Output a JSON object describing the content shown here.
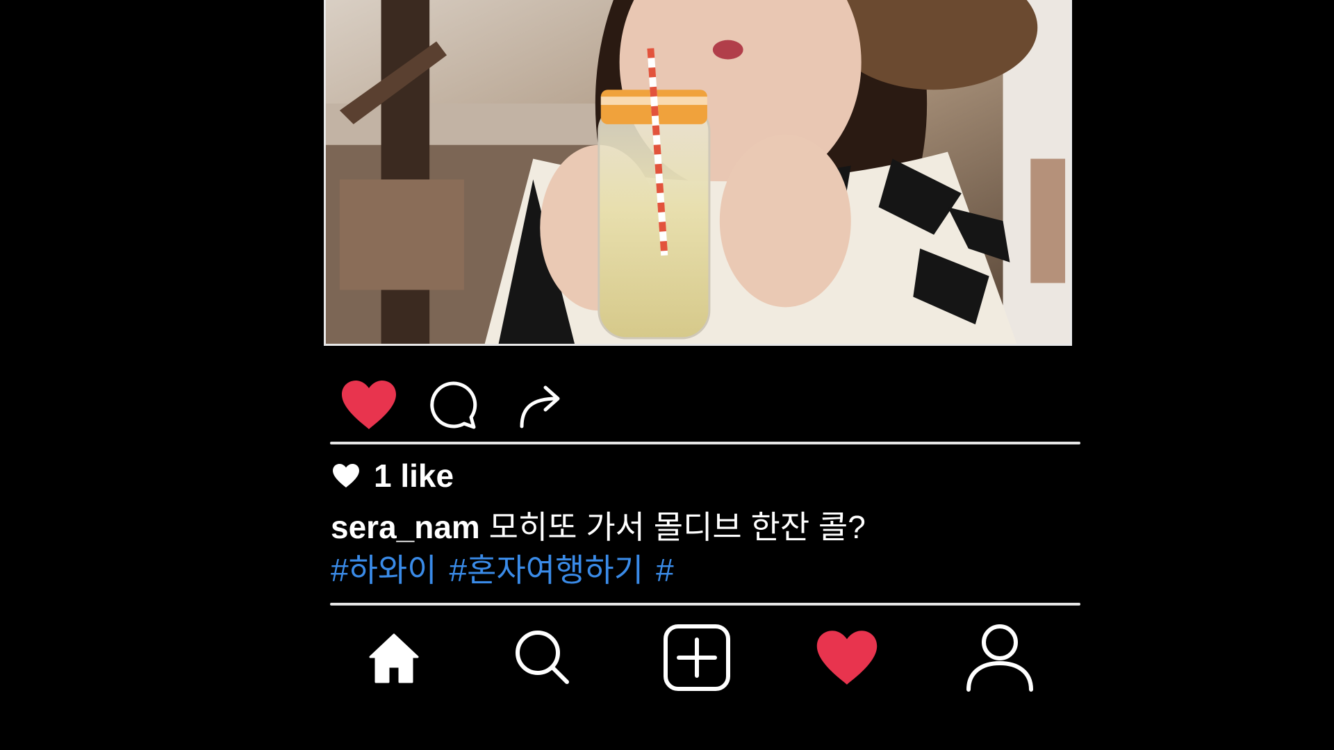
{
  "post": {
    "photo_icon": "photo-image",
    "likes_text": "1 like",
    "username": "sera_nam",
    "caption": "모히또 가서 몰디브 한잔 콜?",
    "hashtags": [
      "#하와이",
      "#혼자여행하기",
      "#"
    ]
  },
  "actions": {
    "like_icon": "heart-filled-icon",
    "comment_icon": "comment-bubble-icon",
    "share_icon": "share-arrow-icon"
  },
  "nav": {
    "items": [
      {
        "icon": "home-icon"
      },
      {
        "icon": "search-icon"
      },
      {
        "icon": "add-post-icon"
      },
      {
        "icon": "heart-filled-icon"
      },
      {
        "icon": "profile-icon"
      }
    ]
  },
  "colors": {
    "background": "#000000",
    "like_red": "#e8344e",
    "hashtag_blue": "#3a8be8",
    "text": "#ffffff"
  }
}
